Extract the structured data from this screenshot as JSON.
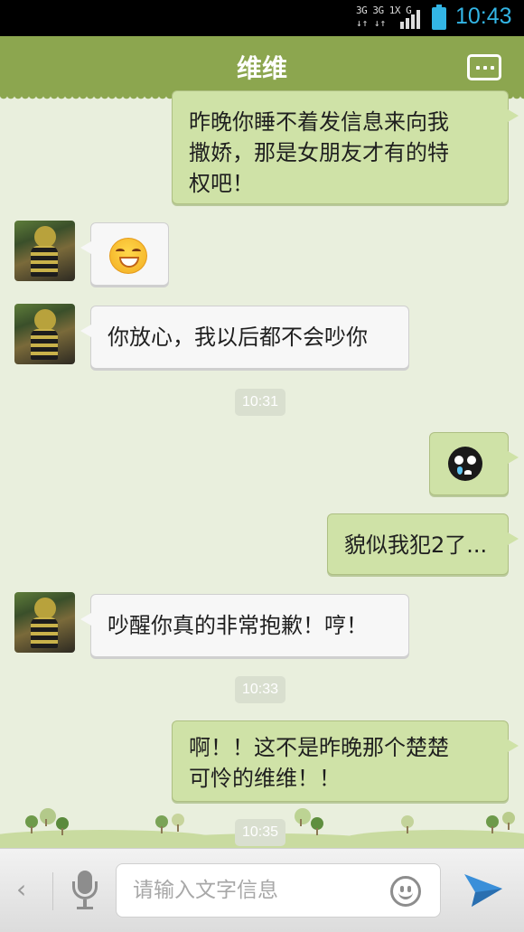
{
  "status_bar": {
    "network": "3G 3G 1X G",
    "arrows": "↓↑ ↓↑",
    "time": "10:43",
    "battery_color": "#33b5e5"
  },
  "header": {
    "title": "维维",
    "menu_icon": "more-icon",
    "color": "#8ca64f"
  },
  "messages": [
    {
      "side": "out",
      "type": "text",
      "lines": [
        "昨晚你睡不着发信息来向我",
        "撒娇，那是女朋友才有的特",
        "权吧！"
      ]
    },
    {
      "side": "in",
      "type": "emoji",
      "emoji": "grinning-face-emoji"
    },
    {
      "side": "in",
      "type": "text",
      "lines": [
        "你放心，我以后都不会吵你"
      ]
    },
    {
      "side": "time",
      "text": "10:31"
    },
    {
      "side": "out",
      "type": "emoji",
      "emoji": "crying-face-emoji"
    },
    {
      "side": "out",
      "type": "text",
      "lines": [
        "貌似我犯2了..."
      ]
    },
    {
      "side": "in",
      "type": "text",
      "lines": [
        "吵醒你真的非常抱歉！哼！"
      ]
    },
    {
      "side": "time",
      "text": "10:33"
    },
    {
      "side": "out",
      "type": "text",
      "lines": [
        "啊！！这不是昨晚那个楚楚",
        "可怜的维维！！"
      ]
    },
    {
      "side": "time",
      "text": "10:35"
    }
  ],
  "input_bar": {
    "placeholder": "请输入文字信息",
    "back_icon": "chevron-left-icon",
    "mic_icon": "microphone-icon",
    "emoji_icon": "smiley-icon",
    "send_icon": "send-icon",
    "send_color": "#3a8fd9"
  }
}
